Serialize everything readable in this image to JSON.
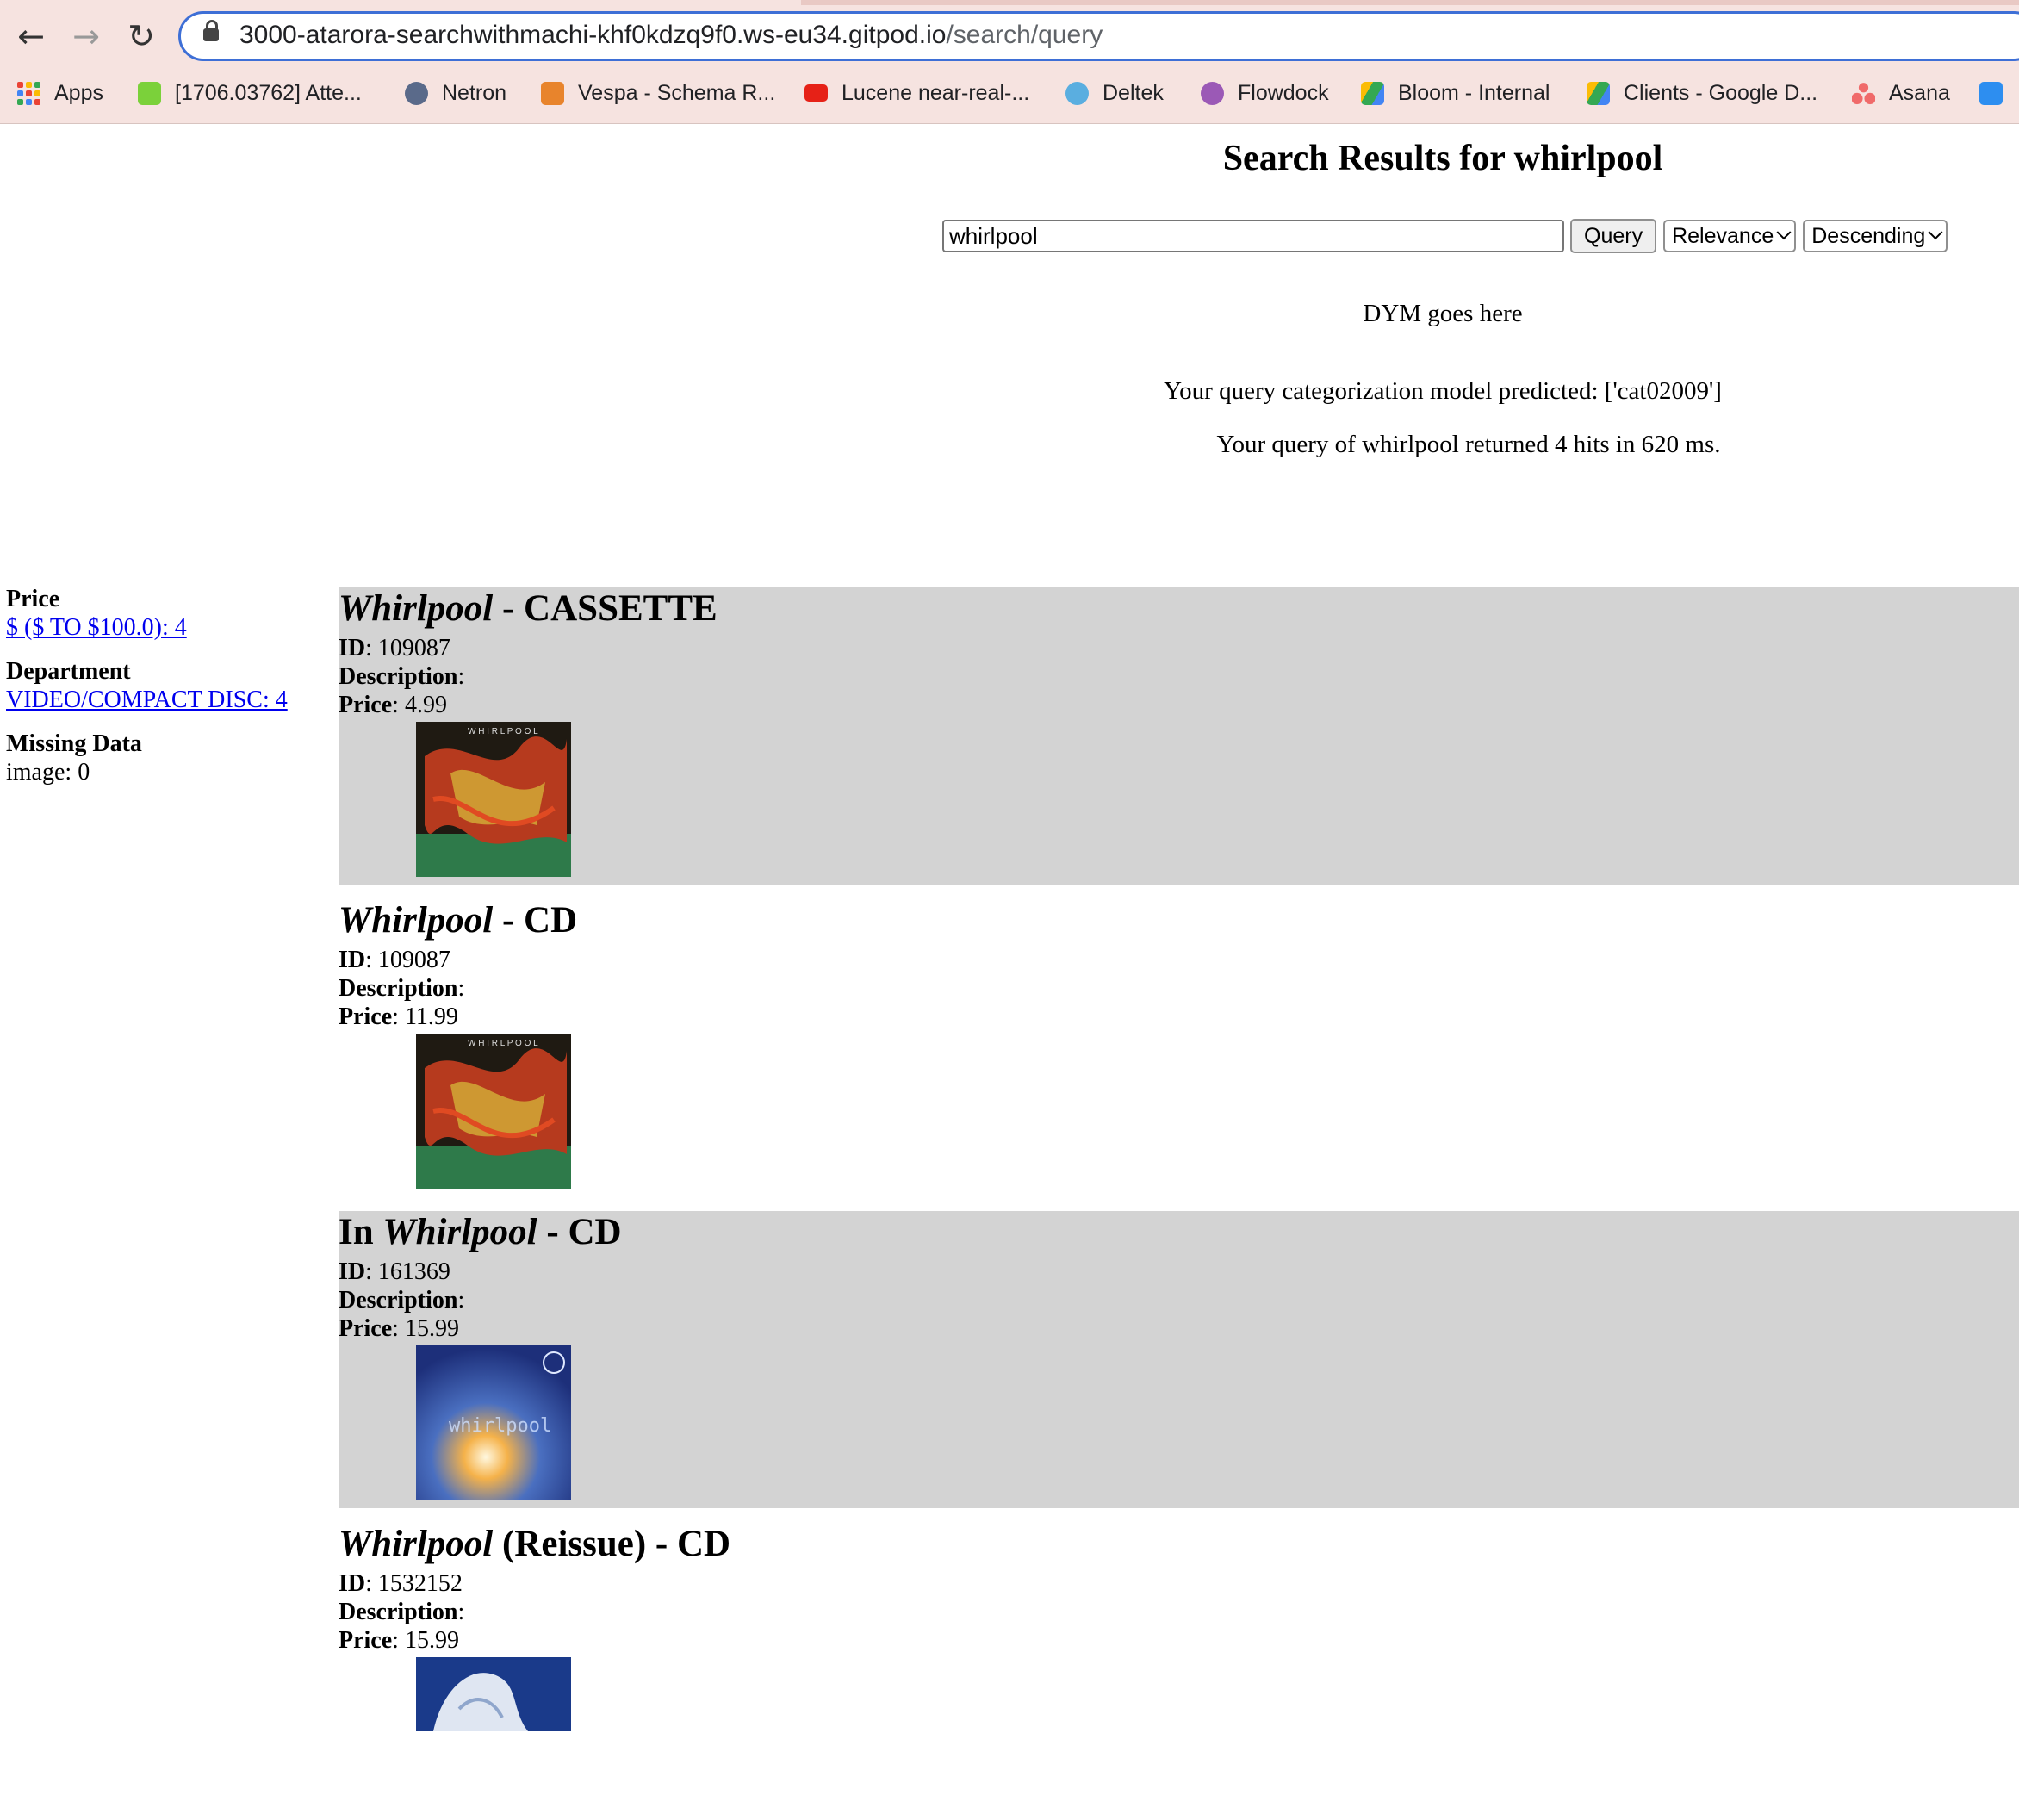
{
  "browser": {
    "url_host": "3000-atarora-searchwithmachi-khf0kdzq9f0.ws-eu34.gitpod.io",
    "url_path": "/search/query",
    "bookmarks": [
      {
        "label": "Apps",
        "icon": "apps-grid-icon"
      },
      {
        "label": "[1706.03762] Atte...",
        "icon": "smiley-icon"
      },
      {
        "label": "Netron",
        "icon": "netron-icon"
      },
      {
        "label": "Vespa - Schema R...",
        "icon": "vespa-icon"
      },
      {
        "label": "Lucene near-real-...",
        "icon": "youtube-icon"
      },
      {
        "label": "Deltek",
        "icon": "deltek-icon"
      },
      {
        "label": "Flowdock",
        "icon": "flowdock-icon"
      },
      {
        "label": "Bloom - Internal",
        "icon": "google-drive-icon"
      },
      {
        "label": "Clients - Google D...",
        "icon": "google-drive-icon"
      },
      {
        "label": "Asana",
        "icon": "asana-icon"
      },
      {
        "label": "",
        "icon": "q-icon"
      }
    ]
  },
  "page": {
    "title": "Search Results for whirlpool",
    "search_value": "whirlpool",
    "query_button": "Query",
    "sort_field": "Relevance",
    "sort_order": "Descending",
    "dym": "DYM goes here",
    "categorization": "Your query categorization model predicted: ['cat02009']",
    "hits_summary": "Your query of whirlpool returned 4 hits in 620 ms."
  },
  "facets": {
    "price_title": "Price",
    "price_link": "$ ($ TO $100.0): 4",
    "department_title": "Department",
    "department_link": "VIDEO/COMPACT DISC: 4",
    "missing_title": "Missing Data",
    "missing_value": "image: 0"
  },
  "labels": {
    "id": "ID",
    "description": "Description",
    "price": "Price"
  },
  "results": [
    {
      "title_pre": "",
      "title_em": "Whirlpool",
      "title_post": " - CASSETTE",
      "id": "109087",
      "description": "",
      "price": "4.99"
    },
    {
      "title_pre": "",
      "title_em": "Whirlpool",
      "title_post": " - CD",
      "id": "109087",
      "description": "",
      "price": "11.99"
    },
    {
      "title_pre": "In ",
      "title_em": "Whirlpool",
      "title_post": " - CD",
      "id": "161369",
      "description": "",
      "price": "15.99"
    },
    {
      "title_pre": "",
      "title_em": "Whirlpool",
      "title_post": " (Reissue) - CD",
      "id": "1532152",
      "description": "",
      "price": "15.99"
    }
  ],
  "colors": {
    "browser_chrome": "#f6e3e0",
    "url_focus_ring": "#3e6fd6",
    "link": "#0000ee",
    "alt_row": "#d3d3d3"
  }
}
